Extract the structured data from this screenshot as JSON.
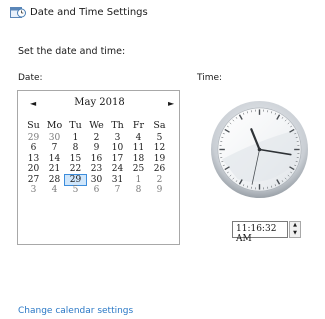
{
  "window": {
    "title": "Date and Time Settings",
    "icon": "date-time-icon"
  },
  "prompt": "Set the date and time:",
  "date_label": "Date:",
  "time_label": "Time:",
  "calendar": {
    "month": "May 2018",
    "prev_icon": "◄",
    "next_icon": "►",
    "weekdays": [
      "Su",
      "Mo",
      "Tu",
      "We",
      "Th",
      "Fr",
      "Sa"
    ],
    "weeks": [
      [
        "29",
        "30",
        "1",
        "2",
        "3",
        "4",
        "5"
      ],
      [
        "6",
        "7",
        "8",
        "9",
        "10",
        "11",
        "12"
      ],
      [
        "13",
        "14",
        "15",
        "16",
        "17",
        "18",
        "19"
      ],
      [
        "20",
        "21",
        "22",
        "23",
        "24",
        "25",
        "26"
      ],
      [
        "27",
        "28",
        "29",
        "30",
        "31",
        "1",
        "2"
      ],
      [
        "3",
        "4",
        "5",
        "6",
        "7",
        "8",
        "9"
      ]
    ],
    "selected": "29"
  },
  "clock": {
    "hour": 11,
    "minute": 16,
    "second": 32
  },
  "time_value": "11:16:32 AM",
  "change_calendar_link": "Change calendar settings",
  "colors": {
    "link": "#2a78c6",
    "selection": "#cfe6fb",
    "selection_border": "#3c8ddc"
  }
}
